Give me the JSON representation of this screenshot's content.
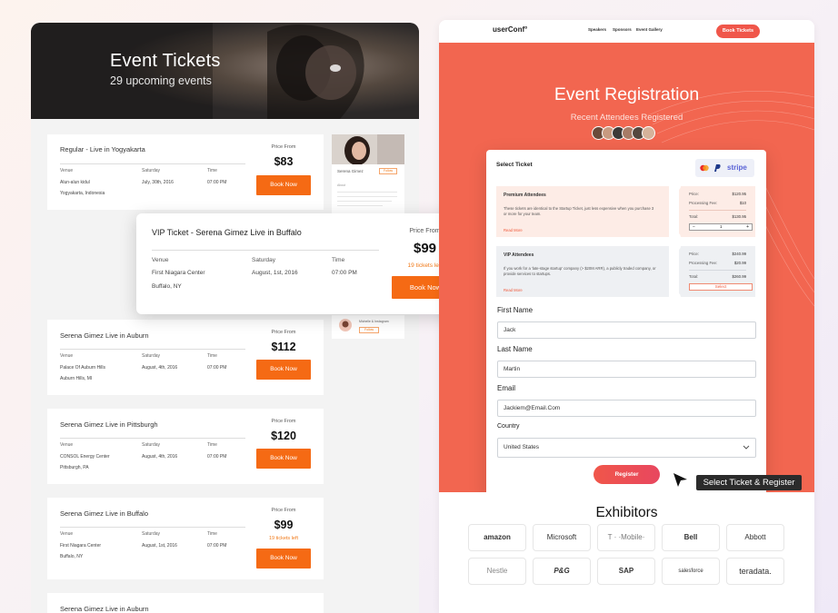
{
  "left": {
    "hero": {
      "title": "Event Tickets",
      "subtitle": "29 upcoming events"
    },
    "tickets": [
      {
        "title": "Regular -  Live in Yogyakarta",
        "venue_label": "Venue",
        "venue": "Alun-alun kidul",
        "address": "Yogyakarta, Indonesia",
        "date_label": "Saturday",
        "date": "July, 30th, 2016",
        "time_label": "Time",
        "time": "07:00 PM",
        "price_label": "Price From",
        "price": "$83",
        "tickets_left": "",
        "button": "Book Now"
      },
      {
        "title": "Serena Gimez Live in Auburn",
        "venue_label": "Venue",
        "venue": "Palace Of Auburn Hills",
        "address": "Auburn Hills, MI",
        "date_label": "Saturday",
        "date": "August, 4th, 2016",
        "time_label": "Time",
        "time": "07:00 PM",
        "price_label": "Price From",
        "price": "$112",
        "tickets_left": "",
        "button": "Book Now"
      },
      {
        "title": "Serena Gimez Live in Pittsburgh",
        "venue_label": "Venue",
        "venue": "CONSOL Energy Center",
        "address": "Pittsburgh, PA",
        "date_label": "Saturday",
        "date": "August, 4th, 2016",
        "time_label": "Time",
        "time": "07:00 PM",
        "price_label": "Price From",
        "price": "$120",
        "tickets_left": "",
        "button": "Book Now"
      },
      {
        "title": "Serena Gimez Live in Buffalo",
        "venue_label": "Venue",
        "venue": "First Niagara Center",
        "address": "Buffalo, NY",
        "date_label": "Saturday",
        "date": "August, 1st, 2016",
        "time_label": "Time",
        "time": "07:00 PM",
        "price_label": "Price From",
        "price": "$99",
        "tickets_left": "19 tickets left",
        "button": "Book Now"
      },
      {
        "title": "Serena Gimez Live in Auburn"
      }
    ],
    "artist_card": {
      "name": "Serena Gimez",
      "button": "Follow",
      "about": "About"
    },
    "artist_card2": {
      "handle": "Michelle & Instagram",
      "button": "Follow"
    },
    "vip": {
      "title": "VIP Ticket - Serena Gimez Live in Buffalo",
      "venue_label": "Venue",
      "venue": "First Niagara Center",
      "address": "Buffalo, NY",
      "date_label": "Saturday",
      "date": "August, 1st, 2016",
      "time_label": "Time",
      "time": "07:00 PM",
      "price_label": "Price From",
      "price": "$99",
      "tickets_left": "19 tickets left",
      "button": "Book Now"
    }
  },
  "right": {
    "nav": {
      "logo": "userConf°",
      "links": [
        "Speakers",
        "Sponsors",
        "Event Gallery"
      ],
      "button": "Book Tickets"
    },
    "title": "Event Registration",
    "subtitle": "Recent Attendees Registered",
    "form": {
      "select_ticket": "Select Ticket",
      "payments": [
        "mastercard",
        "paypal",
        "stripe"
      ],
      "payment_label": "stripe",
      "options": [
        {
          "title": "Premium Attendees",
          "desc": "These tickets are identical to the Startup Ticket, just less expensive when you purchase 3 or more for your team.",
          "read_more": "Read More",
          "price_label": "Price:",
          "price": "$120.95",
          "fee_label": "Processing Fee:",
          "fee": "$10",
          "total_label": "Total:",
          "total": "$130.95",
          "qty_minus": "−",
          "qty": "1",
          "qty_plus": "+"
        },
        {
          "title": "VIP Attendees",
          "desc": "If you work for a 'late-stage startup' company (> $20M ARR), a publicly traded company, or provide services to startups.",
          "read_more": "Read More",
          "price_label": "Price:",
          "price": "$240.99",
          "fee_label": "Processing Fee:",
          "fee": "$20.99",
          "total_label": "Total:",
          "total": "$260.99",
          "select": "Select"
        }
      ],
      "fields": [
        {
          "label": "First Name",
          "value": "Jack"
        },
        {
          "label": "Last Name",
          "value": "Martin"
        },
        {
          "label": "Email",
          "value": "Jackiem@Email.Com"
        }
      ],
      "country_label": "Country",
      "country": "United States",
      "register": "Register"
    },
    "tooltip": "Select Ticket & Register",
    "exhibitors": {
      "title": "Exhibitors",
      "logos": [
        "amazon",
        "Microsoft",
        "T · ·Mobile·",
        "Bell",
        "Abbott",
        "Nestle",
        "P&G",
        "SAP",
        "salesforce",
        "teradata."
      ]
    }
  },
  "colors": {
    "accent_orange": "#f56a14",
    "coral": "#f26650",
    "button_red": "#f0564a"
  }
}
